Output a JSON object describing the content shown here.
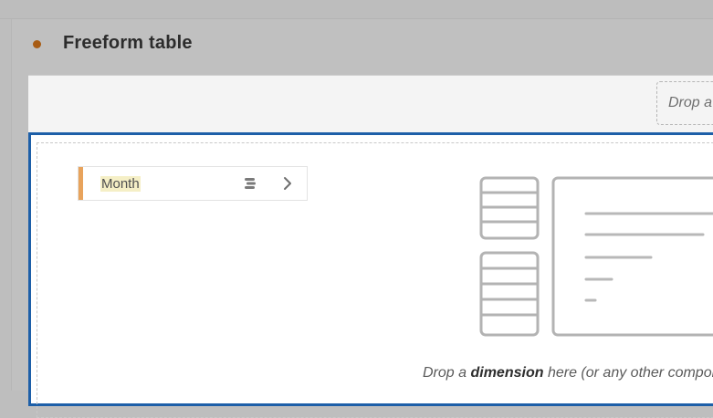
{
  "panel": {
    "title": "Freeform table",
    "dot_color": "#a85c14"
  },
  "drop_zones": {
    "column_header_text": "Drop a"
  },
  "dimension_item": {
    "label": "Month",
    "accent_color": "#e8a35c",
    "highlight_color": "#f5efc6",
    "icon": "segment-stack-icon",
    "chevron": "chevron-right-icon"
  },
  "canvas": {
    "border_color": "#1d5fa8",
    "illustration": "table-placeholder-illustration"
  },
  "drop_hint": {
    "prefix": "Drop a",
    "emphasis": "dimension",
    "suffix": "here (or any other componer"
  }
}
